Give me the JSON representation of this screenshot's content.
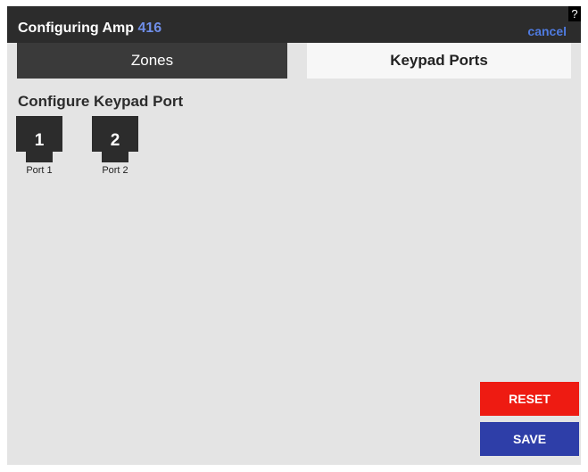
{
  "dialog": {
    "title_prefix": "Configuring Amp",
    "amp_number": "416",
    "cancel_label": "cancel",
    "help_label": "?"
  },
  "tabs": [
    {
      "label": "Zones",
      "active": false
    },
    {
      "label": "Keypad Ports",
      "active": true
    }
  ],
  "content": {
    "section_title": "Configure Keypad Port",
    "ports": [
      {
        "number": "1",
        "label": "Port 1"
      },
      {
        "number": "2",
        "label": "Port 2"
      }
    ]
  },
  "actions": {
    "reset_label": "RESET",
    "save_label": "SAVE"
  },
  "colors": {
    "titlebar": "#2c2c2c",
    "amp_number": "#6f8ee8",
    "cancel_link": "#4f7be0",
    "reset": "#ee1b12",
    "save": "#2e3ea8",
    "background": "#e4e4e4"
  }
}
